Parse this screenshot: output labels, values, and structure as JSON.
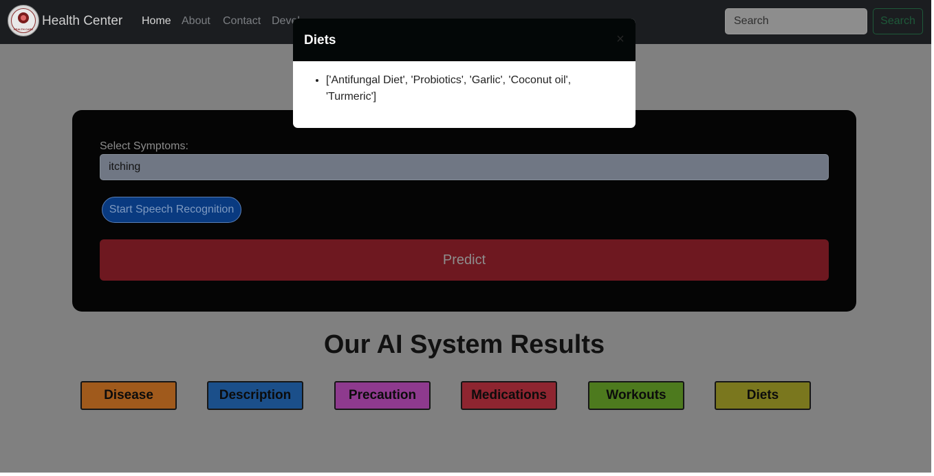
{
  "navbar": {
    "logo_text": "HEALTH CARE",
    "brand": "Health Center",
    "links": [
      "Home",
      "About",
      "Contact",
      "Devel"
    ],
    "search_placeholder": "Search",
    "search_button": "Search"
  },
  "form": {
    "symptoms_label": "Select Symptoms:",
    "symptoms_value": "itching",
    "speech_button": "Start Speech Recognition",
    "predict_button": "Predict"
  },
  "results": {
    "title": "Our AI System Results",
    "buttons": [
      {
        "label": "Disease",
        "color": "#a05a1c"
      },
      {
        "label": "Description",
        "color": "#1b4f8a"
      },
      {
        "label": "Precaution",
        "color": "#8e3a8e"
      },
      {
        "label": "Medications",
        "color": "#8e2530"
      },
      {
        "label": "Workouts",
        "color": "#4d7a1e"
      },
      {
        "label": "Diets",
        "color": "#7a771e"
      }
    ]
  },
  "modal": {
    "title": "Diets",
    "close_glyph": "×",
    "items": [
      "['Antifungal Diet', 'Probiotics', 'Garlic', 'Coconut oil', 'Turmeric']"
    ]
  }
}
